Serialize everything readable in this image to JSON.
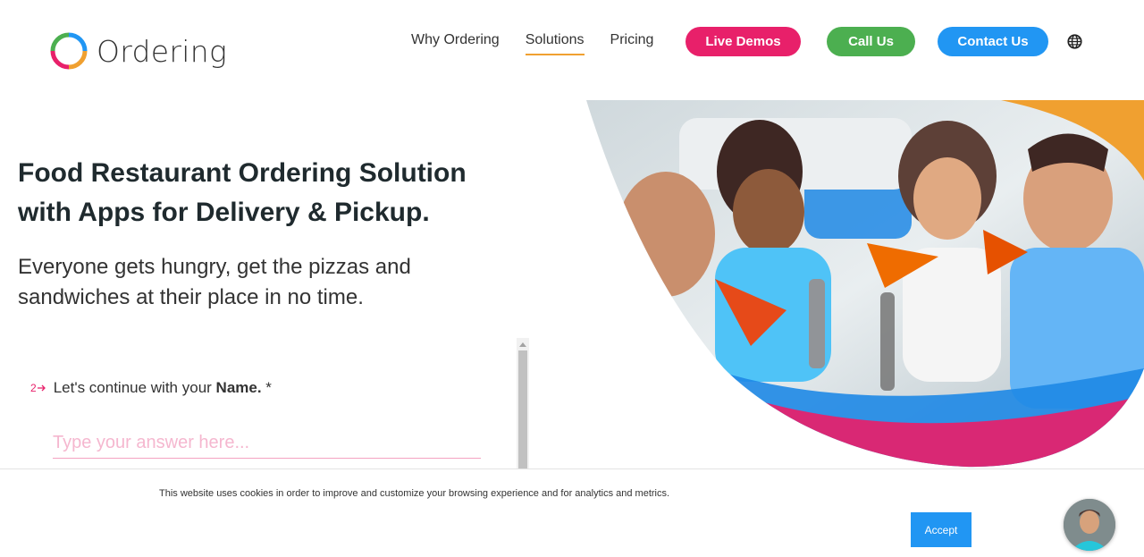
{
  "brand": {
    "name": "Ordering"
  },
  "nav": {
    "links": [
      "Why Ordering",
      "Solutions",
      "Pricing"
    ],
    "active": "Solutions",
    "live_demos": "Live Demos",
    "call_us": "Call Us",
    "contact_us": "Contact Us"
  },
  "hero": {
    "title_line1": "Food Restaurant Ordering Solution",
    "title_line2": "with Apps for Delivery & Pickup.",
    "subtitle_line1": "Everyone gets hungry, get the pizzas and",
    "subtitle_line2": "sandwiches at their place in no time."
  },
  "form": {
    "question_number": "2",
    "question_prefix": "Let's continue with your ",
    "question_bold": "Name.",
    "required_mark": " *",
    "placeholder": "Type your answer here..."
  },
  "cookie": {
    "text": "This website uses cookies in order to improve and customize your browsing experience and for analytics and metrics.",
    "accept": "Accept"
  },
  "colors": {
    "pink": "#e8206a",
    "green": "#4caf50",
    "blue": "#2196f3",
    "orange": "#f0a030"
  },
  "icons": [
    "logo-ring-icon",
    "globe-icon",
    "arrow-right-icon",
    "chevron-up-icon"
  ]
}
